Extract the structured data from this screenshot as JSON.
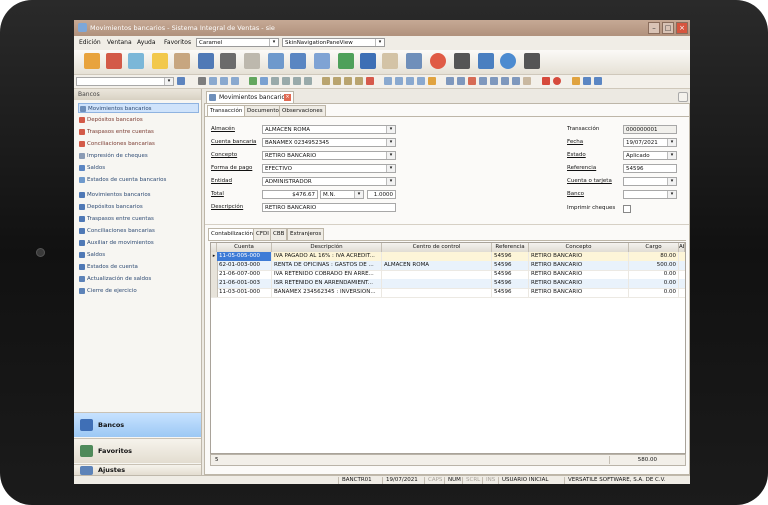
{
  "window": {
    "title": "Movimientos bancarios - Sistema Integral de Ventas - sie"
  },
  "menu": {
    "items": [
      "Edición",
      "Ventana",
      "Ayuda",
      "Favoritos"
    ],
    "theme_combo": "Caramel",
    "skin_combo": "SkinNavigationPaneView"
  },
  "sidebar": {
    "header": "Bancos",
    "items": [
      {
        "label": "Movimientos bancarios",
        "selected": true,
        "icon": "bank-doc-icon"
      },
      {
        "label": "Depósitos bancarios",
        "icon": "deposit-doc-icon"
      },
      {
        "label": "Traspasos entre cuentas",
        "icon": "transfer-doc-icon"
      },
      {
        "label": "Conciliaciones bancarias",
        "icon": "reconcile-doc-icon"
      },
      {
        "label": "Impresión de cheques",
        "icon": "print-check-icon"
      },
      {
        "label": "Saldos",
        "icon": "search-icon"
      },
      {
        "label": "Estados de cuenta bancarios",
        "icon": "refresh-icon"
      },
      {
        "label": "Movimientos bancarios",
        "icon": "report-icon"
      },
      {
        "label": "Depósitos bancarios",
        "icon": "report-icon"
      },
      {
        "label": "Traspasos entre cuentas",
        "icon": "report-icon"
      },
      {
        "label": "Conciliaciones bancarias",
        "icon": "report-icon"
      },
      {
        "label": "Auxiliar de movimientos",
        "icon": "report-icon"
      },
      {
        "label": "Saldos",
        "icon": "report-icon"
      },
      {
        "label": "Estados de cuenta",
        "icon": "report-icon"
      },
      {
        "label": "Actualización de saldos",
        "icon": "gears-icon"
      },
      {
        "label": "Cierre de ejercicio",
        "icon": "gears-icon"
      }
    ],
    "nav_buttons": [
      {
        "label": "Bancos",
        "active": true,
        "icon": "bank-icon"
      },
      {
        "label": "Favoritos",
        "icon": "favorites-icon"
      },
      {
        "label": "Ajustes",
        "icon": "settings-icon"
      }
    ]
  },
  "document": {
    "tab_title": "Movimientos bancarios",
    "subtabs": [
      "Transacción",
      "Documento",
      "Observaciones"
    ],
    "fields": {
      "almacen": {
        "label": "Almacén",
        "value": "ALMACEN ROMA"
      },
      "cuenta_bancaria": {
        "label": "Cuenta bancaria",
        "value": "BANAMEX 0234952345"
      },
      "concepto": {
        "label": "Concepto",
        "value": "RETIRO BANCARIO"
      },
      "forma_pago": {
        "label": "Forma de pago",
        "value": "EFECTIVO"
      },
      "entidad": {
        "label": "Entidad",
        "value": "ADMINISTRADOR"
      },
      "total": {
        "label": "Total",
        "value": "$476.67",
        "currency": "M.N.",
        "rate": "1.0000"
      },
      "descripcion": {
        "label": "Descripción",
        "value": "RETIRO BANCARIO"
      },
      "transaccion": {
        "label": "Transacción",
        "value": "000000001"
      },
      "fecha": {
        "label": "Fecha",
        "value": "19/07/2021"
      },
      "estado": {
        "label": "Estado",
        "value": "Aplicado"
      },
      "referencia": {
        "label": "Referencia",
        "value": "54596"
      },
      "cuenta_tarjeta": {
        "label": "Cuenta o tarjeta",
        "value": ""
      },
      "banco": {
        "label": "Banco",
        "value": ""
      },
      "imprimir_cheques": {
        "label": "Imprimir cheques"
      }
    }
  },
  "grid": {
    "tabs": [
      "Contabilización",
      "CFDI",
      "CBB",
      "Extranjeros"
    ],
    "columns": [
      "Cuenta",
      "Descripción",
      "Centro de control",
      "Referencia",
      "Concepto",
      "Cargo",
      "Abo"
    ],
    "rows": [
      [
        "11-05-005-000",
        "IVA PAGADO AL 16% : IVA ACREDIT...",
        "",
        "54596",
        "RETIRO BANCARIO",
        "80.00"
      ],
      [
        "62-01-003-000",
        "RENTA DE OFICINAS : GASTOS DE ...",
        "ALMACEN ROMA",
        "54596",
        "RETIRO BANCARIO",
        "500.00"
      ],
      [
        "21-06-007-000",
        "IVA RETENIDO COBRADO EN ARRE...",
        "",
        "54596",
        "RETIRO BANCARIO",
        "0.00"
      ],
      [
        "21-06-001-003",
        "ISR RETENIDO EN ARRENDAMIENT...",
        "",
        "54596",
        "RETIRO BANCARIO",
        "0.00"
      ],
      [
        "11-03-001-000",
        "BANAMEX 234562345 : INVERSION...",
        "",
        "54596",
        "RETIRO BANCARIO",
        "0.00"
      ]
    ],
    "footer_count": "5",
    "footer_total": "580.00"
  },
  "statusbar": {
    "module": "BANCTR01",
    "date": "19/07/2021",
    "caps": "CAPS",
    "num": "NUM",
    "scrl": "SCRL",
    "ins": "INS",
    "user": "USUARIO INICIAL",
    "company": "VERSATILE SOFTWARE, S.A. DE C.V."
  },
  "colors": {
    "accent": "#9cc8f4",
    "titlebar": "#b0917c",
    "selection": "#cfe3fb"
  }
}
